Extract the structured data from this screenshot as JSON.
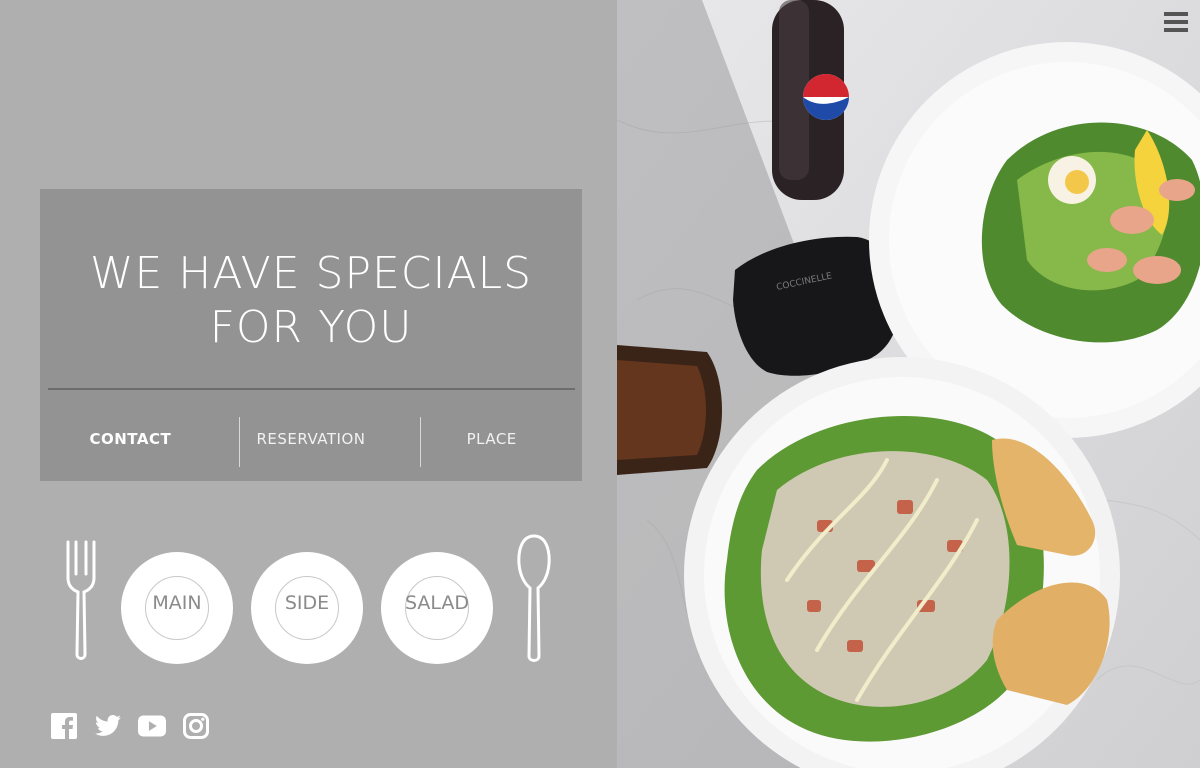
{
  "hero": {
    "title_line1": "WE HAVE SPECIALS",
    "title_line2": "FOR YOU"
  },
  "nav": {
    "items": [
      {
        "label": "CONTACT",
        "active": true
      },
      {
        "label": "RESERVATION",
        "active": false
      },
      {
        "label": "PLACE",
        "active": false
      }
    ]
  },
  "menu": {
    "categories": [
      {
        "label": "MAIN"
      },
      {
        "label": "SIDE"
      },
      {
        "label": "SALAD"
      }
    ]
  },
  "socials": [
    "facebook-icon",
    "twitter-icon",
    "youtube-icon",
    "instagram-icon"
  ],
  "photo": {
    "bottle_brand": "COCCINELLE"
  },
  "colors": {
    "panel": "#afafaf",
    "hero": "#939393",
    "text": "#ffffff"
  }
}
